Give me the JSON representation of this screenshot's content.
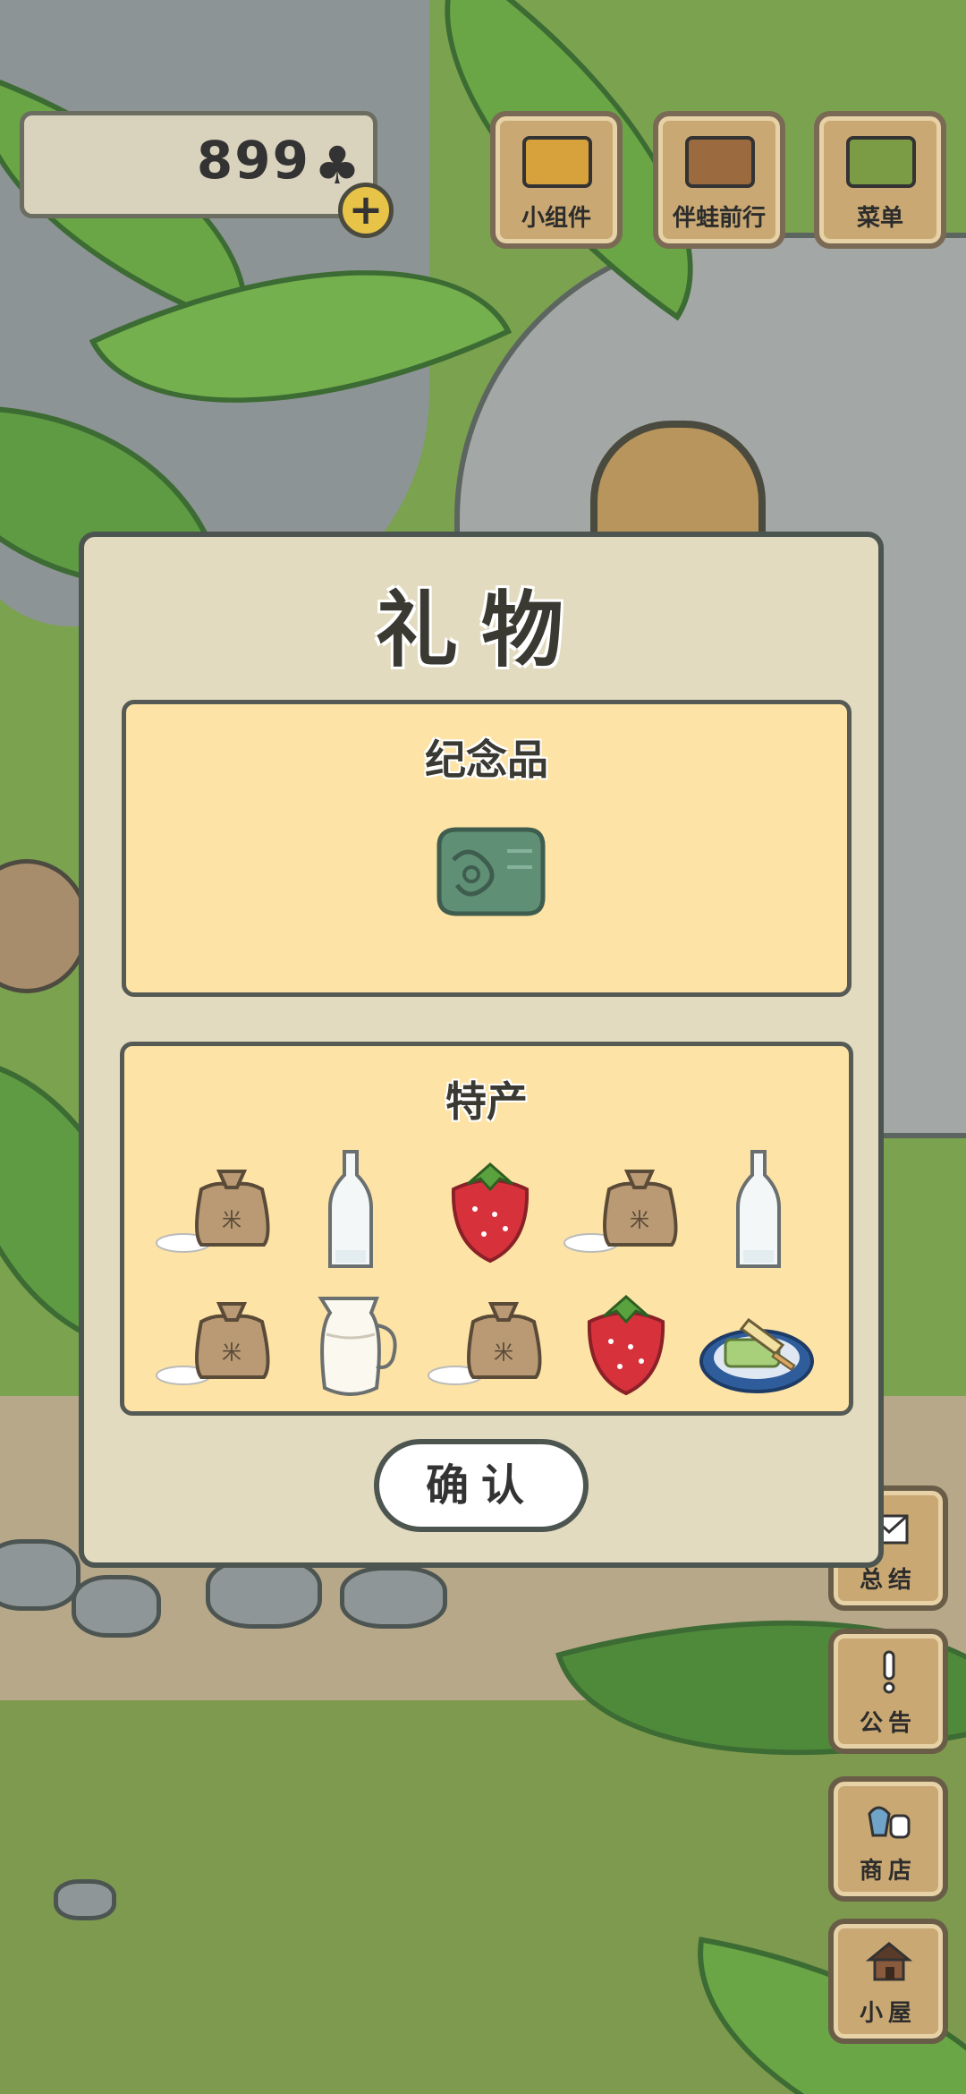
{
  "hud": {
    "clover_count": "899",
    "clover_icon": "clover-icon",
    "plus_label": "+"
  },
  "top_menu": {
    "widget_label": "小组件",
    "travel_label": "伴蛙前行",
    "menu_label": "菜单"
  },
  "side_menu": {
    "summary_label": "总结",
    "notice_label": "公告",
    "shop_label": "商店",
    "home_label": "小屋"
  },
  "gift_dialog": {
    "title": "礼物",
    "souvenir_title": "纪念品",
    "souvenir_item": "jade-plaque-icon",
    "specialty_title": "特产",
    "specialty_items": [
      "rice-bag-icon",
      "glass-bottle-icon",
      "strawberry-icon",
      "rice-bag-icon",
      "glass-bottle-icon",
      "rice-bag-icon",
      "milk-jug-icon",
      "rice-bag-icon",
      "strawberry-icon",
      "popsicle-plate-icon"
    ],
    "confirm_label": "确认"
  }
}
